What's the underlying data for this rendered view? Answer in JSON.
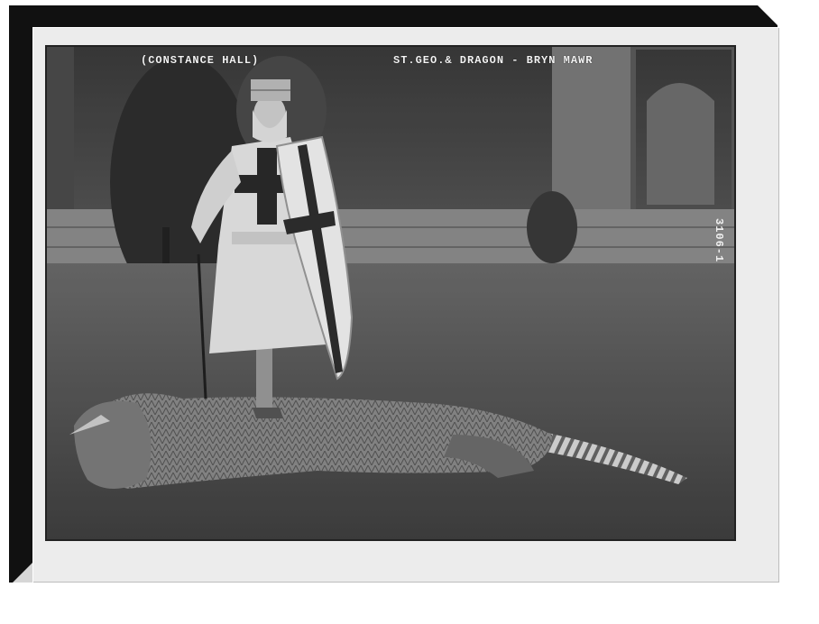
{
  "photo": {
    "caption_left": "(CONSTANCE HALL)",
    "caption_right": "ST.GEO.& DRAGON - BRYN MAWR",
    "negative_number": "3106-1"
  }
}
